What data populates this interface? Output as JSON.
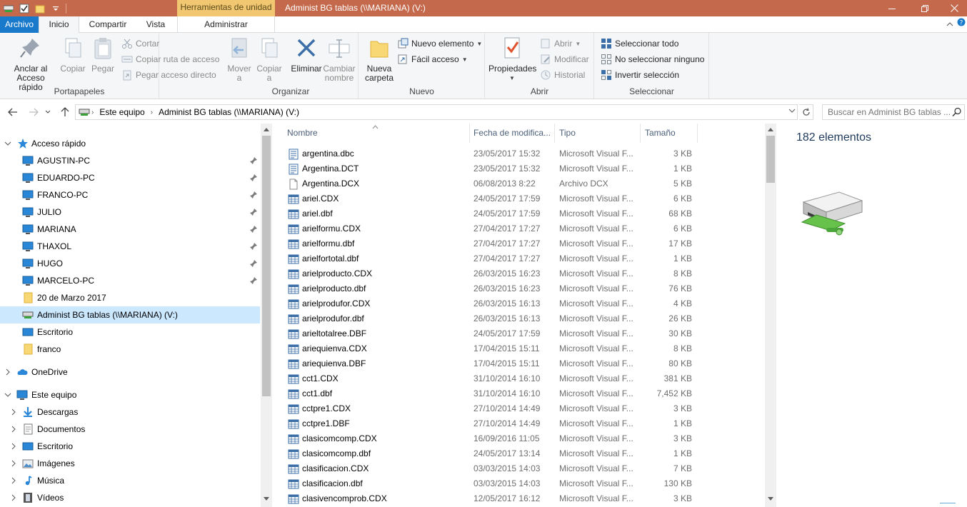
{
  "titlebar": {
    "context_tab": "Herramientas de unidad",
    "title": "Administ BG tablas (\\\\MARIANA) (V:)"
  },
  "tabs": {
    "archivo": "Archivo",
    "inicio": "Inicio",
    "compartir": "Compartir",
    "vista": "Vista",
    "administrar": "Administrar"
  },
  "ribbon": {
    "portapapeles": {
      "label": "Portapapeles",
      "anclar": "Anclar al\nAcceso rápido",
      "copiar": "Copiar",
      "pegar": "Pegar",
      "cortar": "Cortar",
      "copiar_ruta": "Copiar ruta de acceso",
      "pegar_acceso": "Pegar acceso directo"
    },
    "organizar": {
      "label": "Organizar",
      "mover": "Mover\na",
      "copiar_a": "Copiar\na",
      "eliminar": "Eliminar",
      "cambiar_nombre": "Cambiar\nnombre"
    },
    "nuevo": {
      "label": "Nuevo",
      "nueva_carpeta": "Nueva\ncarpeta",
      "nuevo_elemento": "Nuevo elemento",
      "facil_acceso": "Fácil acceso"
    },
    "abrir": {
      "label": "Abrir",
      "propiedades": "Propiedades",
      "abrir": "Abrir",
      "modificar": "Modificar",
      "historial": "Historial"
    },
    "seleccionar": {
      "label": "Seleccionar",
      "todo": "Seleccionar todo",
      "ninguno": "No seleccionar ninguno",
      "invertir": "Invertir selección"
    }
  },
  "address": {
    "segments": [
      "Este equipo",
      "Administ BG tablas (\\\\MARIANA) (V:)"
    ],
    "search_placeholder": "Buscar en Administ BG tablas ..."
  },
  "nav": {
    "quick_access": "Acceso rápido",
    "pinned": [
      "AGUSTIN-PC",
      "EDUARDO-PC",
      "FRANCO-PC",
      "JULIO",
      "MARIANA",
      "THAXOL",
      "HUGO",
      "MARCELO-PC"
    ],
    "recent": [
      "20 de Marzo 2017",
      "Administ BG tablas (\\\\MARIANA) (V:)",
      "Escritorio",
      "franco"
    ],
    "onedrive": "OneDrive",
    "este_equipo": "Este equipo",
    "pc_items": [
      "Descargas",
      "Documentos",
      "Escritorio",
      "Imágenes",
      "Música",
      "Vídeos"
    ]
  },
  "columns": {
    "name": "Nombre",
    "date": "Fecha de modifica...",
    "type": "Tipo",
    "size": "Tamaño"
  },
  "files": [
    {
      "name": "argentina.dbc",
      "date": "23/05/2017 15:32",
      "type": "Microsoft Visual F...",
      "size": "3 KB",
      "icon": "vfp-doc-icon"
    },
    {
      "name": "Argentina.DCT",
      "date": "23/05/2017 15:32",
      "type": "Microsoft Visual F...",
      "size": "1 KB",
      "icon": "vfp-doc-icon"
    },
    {
      "name": "Argentina.DCX",
      "date": "06/08/2013 8:22",
      "type": "Archivo DCX",
      "size": "5 KB",
      "icon": "blank-file-icon"
    },
    {
      "name": "ariel.CDX",
      "date": "24/05/2017 17:59",
      "type": "Microsoft Visual F...",
      "size": "6 KB",
      "icon": "table-file-icon"
    },
    {
      "name": "ariel.dbf",
      "date": "24/05/2017 17:59",
      "type": "Microsoft Visual F...",
      "size": "68 KB",
      "icon": "table-file-icon"
    },
    {
      "name": "arielformu.CDX",
      "date": "27/04/2017 17:27",
      "type": "Microsoft Visual F...",
      "size": "6 KB",
      "icon": "table-file-icon"
    },
    {
      "name": "arielformu.dbf",
      "date": "27/04/2017 17:27",
      "type": "Microsoft Visual F...",
      "size": "17 KB",
      "icon": "table-file-icon"
    },
    {
      "name": "arielfortotal.dbf",
      "date": "27/04/2017 17:27",
      "type": "Microsoft Visual F...",
      "size": "1 KB",
      "icon": "table-file-icon"
    },
    {
      "name": "arielproducto.CDX",
      "date": "26/03/2015 16:23",
      "type": "Microsoft Visual F...",
      "size": "8 KB",
      "icon": "table-file-icon"
    },
    {
      "name": "arielproducto.dbf",
      "date": "26/03/2015 16:23",
      "type": "Microsoft Visual F...",
      "size": "76 KB",
      "icon": "table-file-icon"
    },
    {
      "name": "arielprodufor.CDX",
      "date": "26/03/2015 16:13",
      "type": "Microsoft Visual F...",
      "size": "4 KB",
      "icon": "table-file-icon"
    },
    {
      "name": "arielprodufor.dbf",
      "date": "26/03/2015 16:13",
      "type": "Microsoft Visual F...",
      "size": "26 KB",
      "icon": "table-file-icon"
    },
    {
      "name": "arieltotalree.DBF",
      "date": "24/05/2017 17:59",
      "type": "Microsoft Visual F...",
      "size": "30 KB",
      "icon": "table-file-icon"
    },
    {
      "name": "ariequienva.CDX",
      "date": "17/04/2015 15:11",
      "type": "Microsoft Visual F...",
      "size": "8 KB",
      "icon": "table-file-icon"
    },
    {
      "name": "ariequienva.DBF",
      "date": "17/04/2015 15:11",
      "type": "Microsoft Visual F...",
      "size": "80 KB",
      "icon": "table-file-icon"
    },
    {
      "name": "cct1.CDX",
      "date": "31/10/2014 16:10",
      "type": "Microsoft Visual F...",
      "size": "381 KB",
      "icon": "table-file-icon"
    },
    {
      "name": "cct1.dbf",
      "date": "31/10/2014 16:10",
      "type": "Microsoft Visual F...",
      "size": "7,452 KB",
      "icon": "table-file-icon"
    },
    {
      "name": "cctpre1.CDX",
      "date": "27/10/2014 14:49",
      "type": "Microsoft Visual F...",
      "size": "3 KB",
      "icon": "table-file-icon"
    },
    {
      "name": "cctpre1.DBF",
      "date": "27/10/2014 14:49",
      "type": "Microsoft Visual F...",
      "size": "1 KB",
      "icon": "table-file-icon"
    },
    {
      "name": "clasicomcomp.CDX",
      "date": "16/09/2016 11:05",
      "type": "Microsoft Visual F...",
      "size": "3 KB",
      "icon": "table-file-icon"
    },
    {
      "name": "clasicomcomp.dbf",
      "date": "24/05/2017 13:14",
      "type": "Microsoft Visual F...",
      "size": "1 KB",
      "icon": "table-file-icon"
    },
    {
      "name": "clasificacion.CDX",
      "date": "03/03/2015 14:03",
      "type": "Microsoft Visual F...",
      "size": "7 KB",
      "icon": "table-file-icon"
    },
    {
      "name": "clasificacion.dbf",
      "date": "03/03/2015 14:03",
      "type": "Microsoft Visual F...",
      "size": "130 KB",
      "icon": "table-file-icon"
    },
    {
      "name": "clasivencomprob.CDX",
      "date": "12/05/2017 16:12",
      "type": "Microsoft Visual F...",
      "size": "3 KB",
      "icon": "table-file-icon"
    }
  ],
  "details": {
    "item_count": "182 elementos"
  },
  "colors": {
    "titlebar": "#c4694c",
    "context_tab": "#f1c771",
    "file_tab": "#1979ca",
    "selection": "#cce8ff"
  }
}
